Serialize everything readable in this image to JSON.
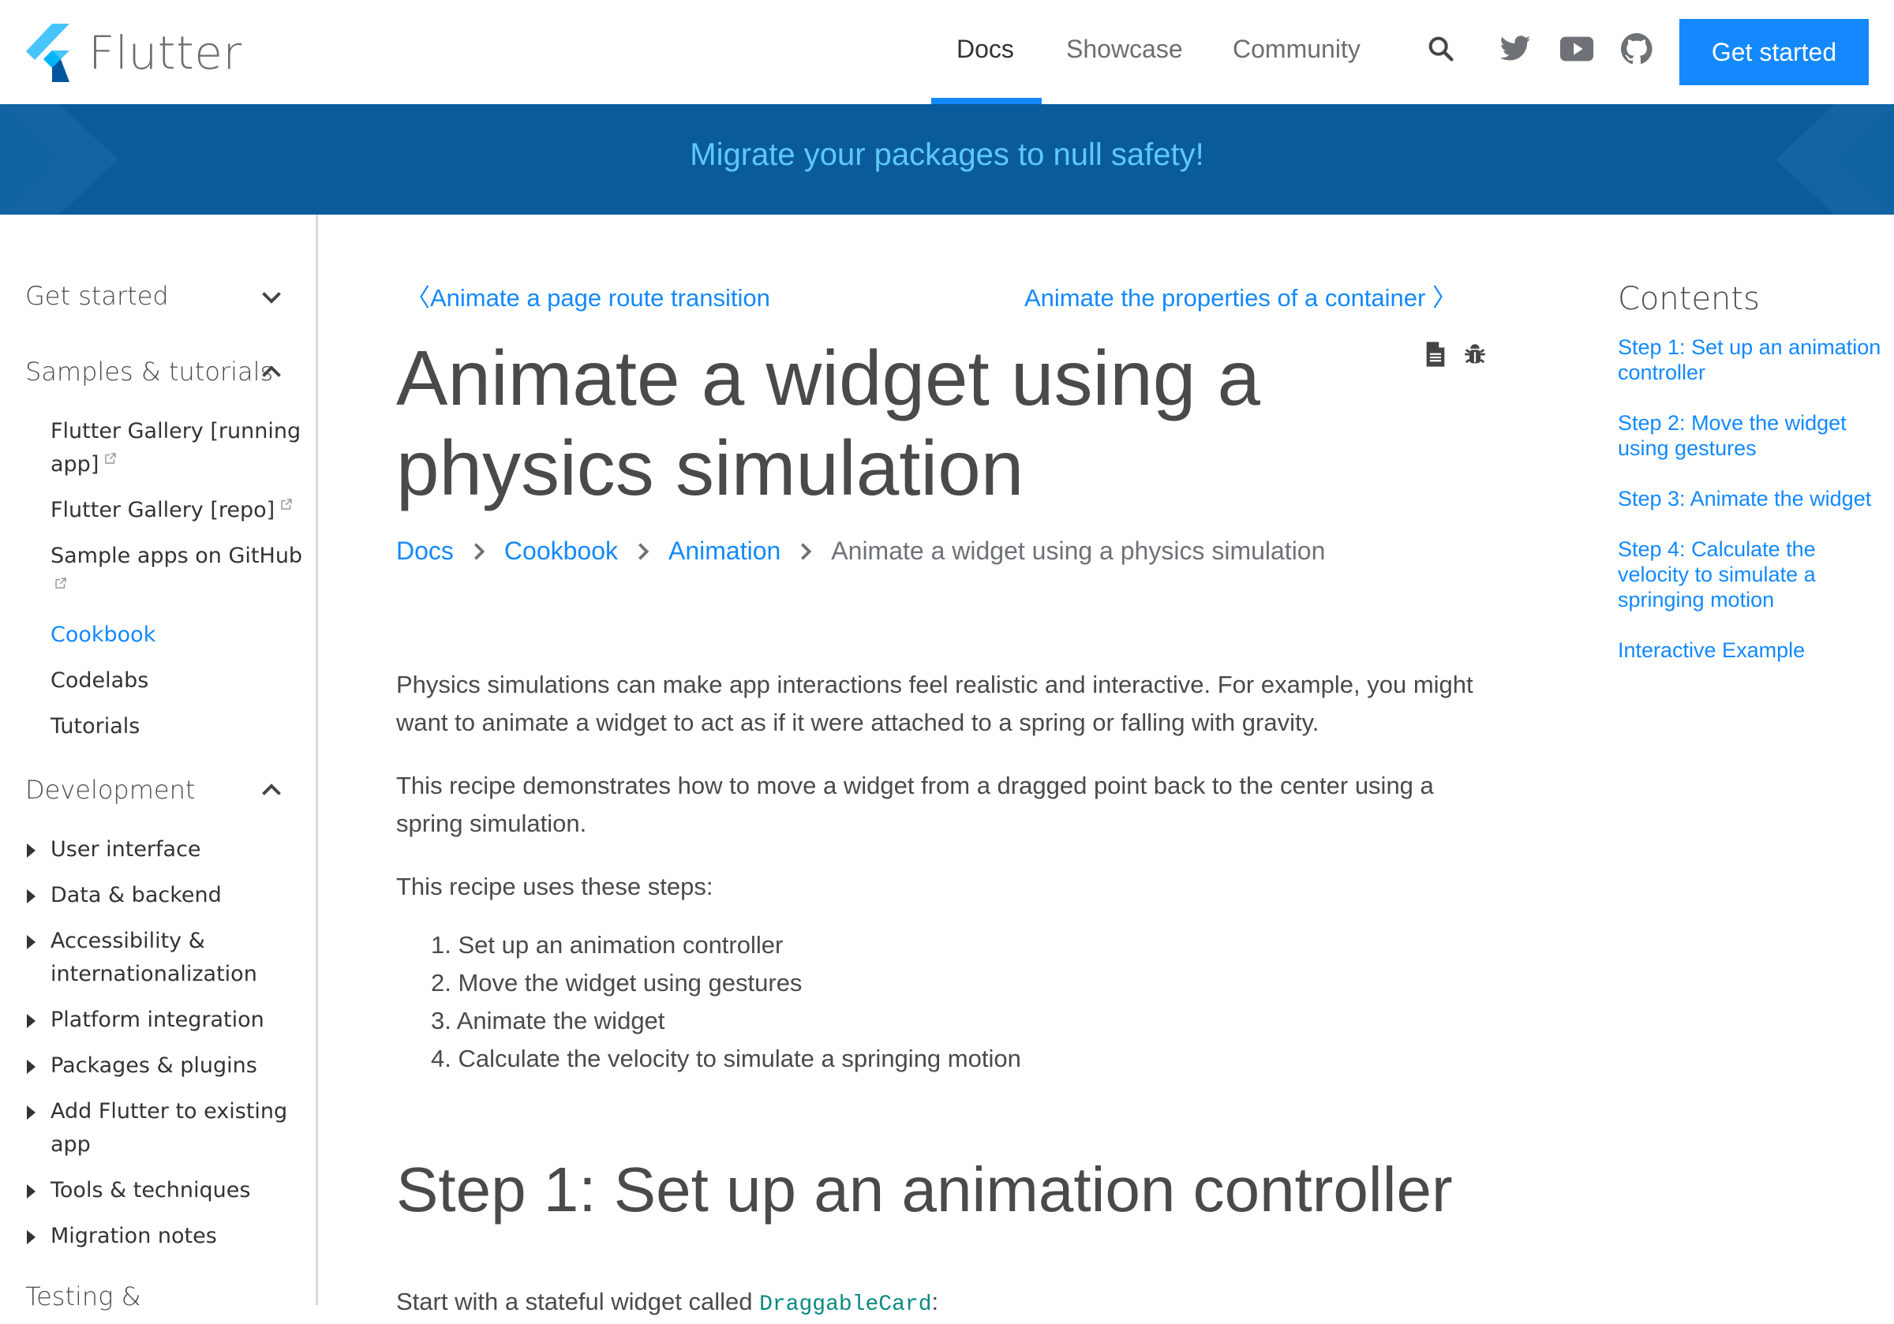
{
  "header": {
    "brand": "Flutter",
    "nav": [
      {
        "label": "Docs",
        "active": true
      },
      {
        "label": "Showcase",
        "active": false
      },
      {
        "label": "Community",
        "active": false
      }
    ],
    "icons": [
      "search-icon",
      "twitter-icon",
      "youtube-icon",
      "github-icon"
    ],
    "cta_label": "Get started",
    "accent_color": "#1389fd"
  },
  "banner": {
    "text": "Migrate your packages to null safety!",
    "bg_color": "#095b9c",
    "text_color": "#5ec8f8"
  },
  "sidebar": {
    "sections": [
      {
        "label": "Get started",
        "expanded": false
      },
      {
        "label": "Samples & tutorials",
        "expanded": true,
        "items": [
          {
            "label": "Flutter Gallery [running app]",
            "external": true
          },
          {
            "label": "Flutter Gallery [repo]",
            "external": true
          },
          {
            "label": "Sample apps on GitHub",
            "external": true
          },
          {
            "label": "Cookbook",
            "active": true
          },
          {
            "label": "Codelabs"
          },
          {
            "label": "Tutorials"
          }
        ]
      },
      {
        "label": "Development",
        "expanded": true,
        "items": [
          {
            "label": "User interface"
          },
          {
            "label": "Data & backend"
          },
          {
            "label": "Accessibility & internationalization"
          },
          {
            "label": "Platform integration"
          },
          {
            "label": "Packages & plugins"
          },
          {
            "label": "Add Flutter to existing app"
          },
          {
            "label": "Tools & techniques"
          },
          {
            "label": "Migration notes"
          }
        ]
      },
      {
        "label": "Testing &",
        "expanded": false
      }
    ]
  },
  "main": {
    "prev_link": "Animate a page route transition",
    "next_link": "Animate the properties of a container",
    "title": "Animate a widget using a physics simulation",
    "page_icons": [
      "view-source-icon",
      "report-bug-icon"
    ],
    "breadcrumbs": [
      {
        "label": "Docs",
        "link": true
      },
      {
        "label": "Cookbook",
        "link": true
      },
      {
        "label": "Animation",
        "link": true
      },
      {
        "label": "Animate a widget using a physics simulation",
        "link": false
      }
    ],
    "paragraphs": [
      "Physics simulations can make app interactions feel realistic and interactive. For example, you might want to animate a widget to act as if it were attached to a spring or falling with gravity.",
      "This recipe demonstrates how to move a widget from a dragged point back to the center using a spring simulation.",
      "This recipe uses these steps:"
    ],
    "steps": [
      "1. Set up an animation controller",
      "2. Move the widget using gestures",
      "3. Animate the widget",
      "4. Calculate the velocity to simulate a springing motion"
    ],
    "section_heading": "Step 1: Set up an animation controller",
    "section_intro_text": "Start with a stateful widget called ",
    "section_intro_code": "DraggableCard",
    "section_intro_suffix": ":"
  },
  "toc": {
    "title": "Contents",
    "items": [
      "Step 1: Set up an animation controller",
      "Step 2: Move the widget using gestures",
      "Step 3: Animate the widget",
      "Step 4: Calculate the velocity to simulate a springing motion",
      "Interactive Example"
    ]
  }
}
